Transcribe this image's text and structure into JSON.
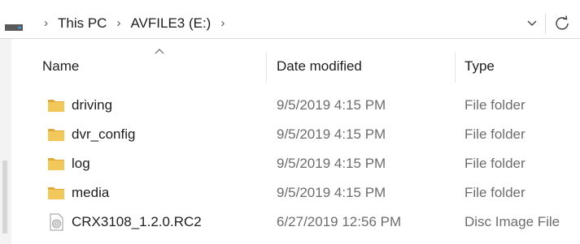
{
  "address": {
    "crumbs": [
      "This PC",
      "AVFILE3 (E:)"
    ],
    "separator": "›",
    "drive_icon": "drive-icon",
    "dropdown_icon": "chevron-down-icon",
    "refresh_icon": "refresh-icon"
  },
  "columns": {
    "name": "Name",
    "date": "Date modified",
    "type": "Type",
    "sort_column": "name",
    "sort_direction": "ascending"
  },
  "files": [
    {
      "name": "driving",
      "date": "9/5/2019 4:15 PM",
      "type": "File folder",
      "icon": "folder-icon"
    },
    {
      "name": "dvr_config",
      "date": "9/5/2019 4:15 PM",
      "type": "File folder",
      "icon": "folder-icon"
    },
    {
      "name": "log",
      "date": "9/5/2019 4:15 PM",
      "type": "File folder",
      "icon": "folder-icon"
    },
    {
      "name": "media",
      "date": "9/5/2019 4:15 PM",
      "type": "File folder",
      "icon": "folder-icon"
    },
    {
      "name": "CRX3108_1.2.0.RC2",
      "date": "6/27/2019 12:56 PM",
      "type": "Disc Image File",
      "icon": "disc-image-icon"
    }
  ],
  "colors": {
    "folder": "#f2c85b",
    "folder_dark": "#e0a93a",
    "text": "#1e1e1e",
    "muted_text": "#6d6d6d"
  }
}
